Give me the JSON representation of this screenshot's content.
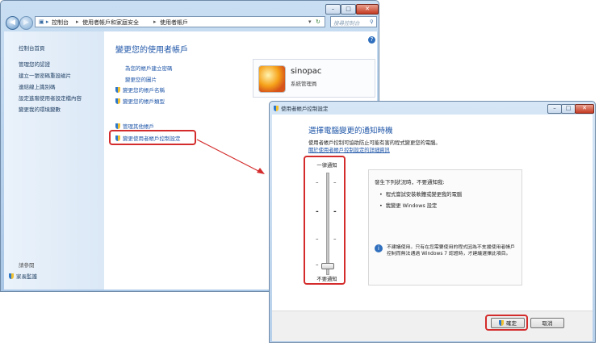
{
  "control_panel": {
    "window_controls": [
      "–",
      "□",
      "✕"
    ],
    "breadcrumb": [
      "控制台",
      "使用者帳戶和家庭安全",
      "使用者帳戶"
    ],
    "search_placeholder": "搜尋控制台",
    "sidebar": {
      "home": "控制台首頁",
      "items": [
        "管理您的認證",
        "建立一張密碼重設磁片",
        "連結線上識別碼",
        "設定進階使用者設定檔內容",
        "變更我的環境變數"
      ],
      "see_also_title": "請參閱",
      "see_also_item": "家長監護"
    },
    "main": {
      "title": "變更您的使用者帳戶",
      "links": [
        "為您的帳戶建立密碼",
        "變更您的圖片",
        "變更您的帳戶名稱",
        "變更您的帳戶類型"
      ],
      "links2": [
        "管理其他帳戶",
        "變更使用者帳戶控制設定"
      ]
    },
    "user": {
      "name": "sinopac",
      "role": "系統管理員"
    }
  },
  "uac": {
    "window_title": "使用者帳戶控制設定",
    "window_controls": [
      "–",
      "□",
      "✕"
    ],
    "heading": "選擇電腦變更的通知時機",
    "description": "使用者帳戶控制可協助防止可能有害的程式變更您的電腦。",
    "more_info_link": "關於使用者帳戶控制設定的詳細資訊",
    "slider_top_label": "一律通知",
    "slider_bottom_label": "不要通知",
    "slider_level": 0,
    "info_title": "發生下列狀況時，不要通知我:",
    "bullets": [
      "程式嘗試安裝軟體或變更我的電腦",
      "我變更 Windows 設定"
    ],
    "note": "不建議使用。只有在您需要使用的程式因為不支援使用者帳戶控制而無法通過 Windows 7 認證時，才建議選擇此項目。",
    "ok_button": "確定",
    "cancel_button": "取消"
  },
  "colors": {
    "highlight": "#d42c2c",
    "link": "#1f56a8",
    "title": "#1f56a8"
  }
}
